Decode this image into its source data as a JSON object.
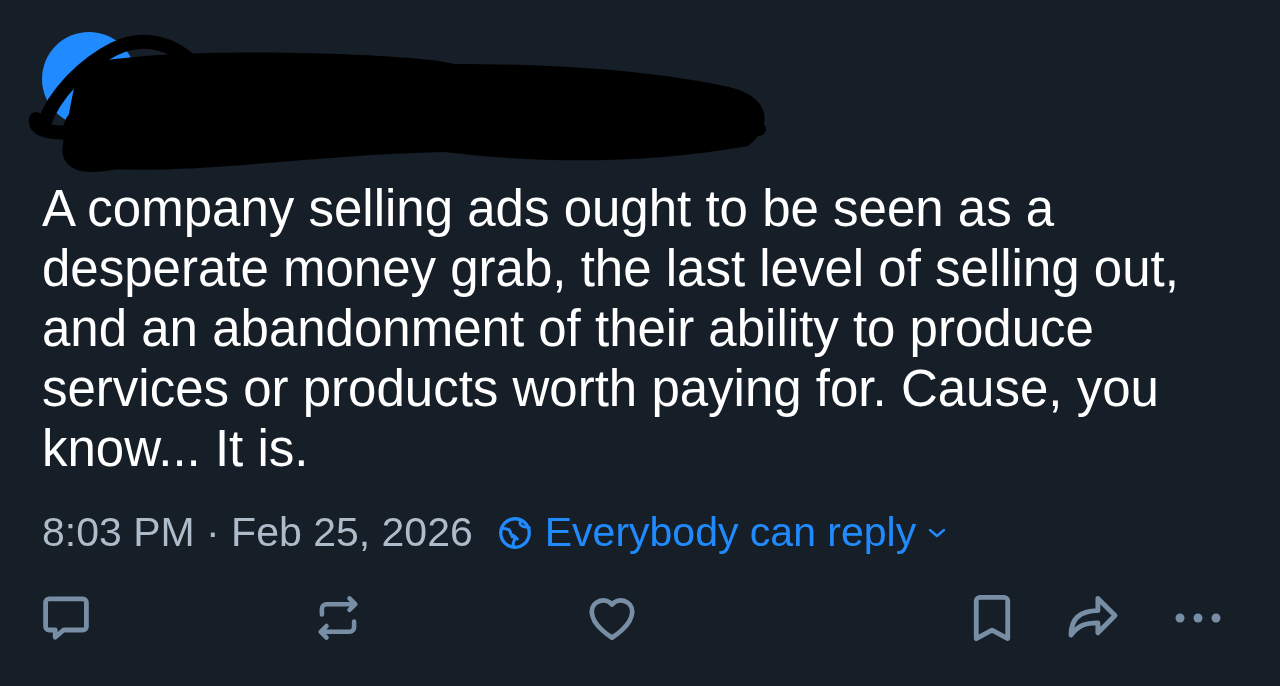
{
  "post": {
    "body": "A company selling ads ought to be seen as a desperate money grab, the last level of selling out, and an abandonment of their ability to produce services or products worth paying for. Cause, you know... It is.",
    "timestamp": "8:03 PM · Feb 25, 2026",
    "reply_setting": "Everybody can reply"
  },
  "actions": [
    {
      "kind": "reply"
    },
    {
      "kind": "repost"
    },
    {
      "kind": "like"
    },
    {
      "kind": "bookmark"
    },
    {
      "kind": "share"
    },
    {
      "kind": "more"
    }
  ]
}
